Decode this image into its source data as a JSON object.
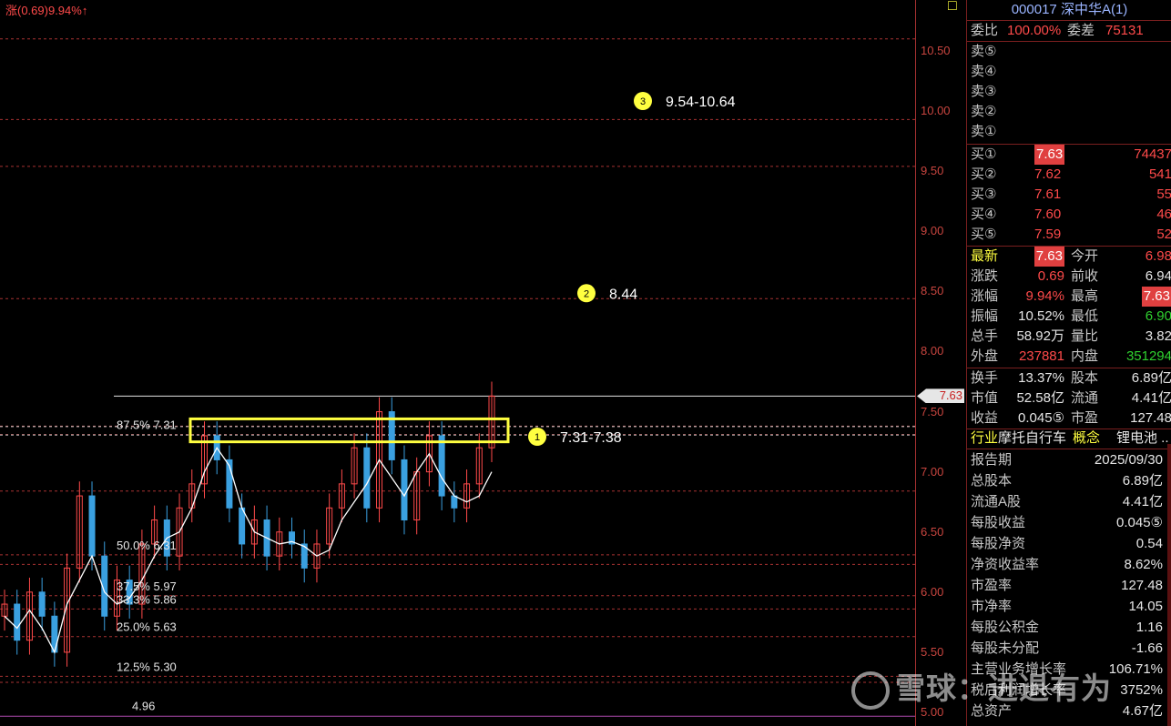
{
  "header": {
    "change_text": "涨(0.69)9.94%↑",
    "toggle_glyph": "□"
  },
  "colors": {
    "up": "#ff4a4a",
    "down": "#2fd12f",
    "accent": "#ffff40",
    "grid": "#a83232",
    "ma": "#ffffff",
    "background": "#000000"
  },
  "axis": {
    "ticks": [
      "10.50",
      "10.00",
      "9.50",
      "9.00",
      "8.50",
      "8.00",
      "7.50",
      "7.00",
      "6.50",
      "6.00",
      "5.50",
      "5.00"
    ],
    "tick_values": [
      10.5,
      10.0,
      9.5,
      9.0,
      8.5,
      8.0,
      7.5,
      7.0,
      6.5,
      6.0,
      5.5,
      5.0
    ],
    "current_price_tag": "7.63",
    "current_price": 7.63
  },
  "chart_data": {
    "type": "candlestick",
    "ylim": [
      4.96,
      10.7
    ],
    "current_price": 7.63,
    "fib_levels": [
      {
        "label": "87.5% 7.31",
        "value": 7.31
      },
      {
        "label": "50.0% 6.31",
        "value": 6.31
      },
      {
        "label": "37.5% 5.97",
        "value": 5.97
      },
      {
        "label": "33.3% 5.86",
        "value": 5.86
      },
      {
        "label": "25.0% 5.63",
        "value": 5.63
      },
      {
        "label": "12.5% 5.30",
        "value": 5.3
      }
    ],
    "low_label": "4.96",
    "low_value": 4.96,
    "resistance_zone": {
      "low": 7.31,
      "high": 7.38
    },
    "targets": [
      {
        "number": "1",
        "text": "7.31-7.38",
        "value": 7.31
      },
      {
        "number": "2",
        "text": "8.44",
        "value": 8.44
      },
      {
        "number": "3",
        "text": "9.54-10.64",
        "value": 9.94
      }
    ],
    "dashed_levels": [
      10.6,
      9.93,
      9.54,
      8.44,
      7.38,
      7.31,
      6.84,
      6.31,
      6.23,
      5.97,
      5.86,
      5.63,
      5.3,
      5.25
    ],
    "ma_line": [
      5.8,
      5.7,
      5.85,
      5.7,
      5.5,
      5.9,
      6.1,
      6.3,
      6.0,
      5.9,
      5.95,
      6.1,
      6.3,
      6.45,
      6.5,
      6.7,
      7.0,
      7.2,
      7.05,
      6.7,
      6.5,
      6.45,
      6.4,
      6.42,
      6.38,
      6.3,
      6.35,
      6.6,
      6.75,
      6.9,
      7.1,
      6.95,
      6.8,
      7.0,
      7.15,
      6.95,
      6.8,
      6.75,
      6.8,
      7.0
    ],
    "candles_close": [
      5.9,
      5.6,
      6.0,
      5.8,
      5.5,
      6.2,
      6.8,
      6.3,
      5.8,
      6.1,
      5.9,
      6.4,
      6.6,
      6.3,
      6.7,
      6.9,
      7.3,
      7.1,
      6.7,
      6.4,
      6.6,
      6.3,
      6.5,
      6.4,
      6.2,
      6.4,
      6.7,
      6.9,
      7.2,
      6.7,
      7.5,
      7.1,
      6.6,
      7.0,
      7.3,
      6.8,
      6.7,
      6.9,
      7.2,
      7.63
    ]
  },
  "quote_panel": {
    "title": "000017 深中华A(1)",
    "weibi_label": "委比",
    "weibi_value": "100.00%",
    "weicha_label": "委差",
    "weicha_value": "75131",
    "sells": [
      {
        "label": "卖⑤"
      },
      {
        "label": "卖④"
      },
      {
        "label": "卖③"
      },
      {
        "label": "卖②"
      },
      {
        "label": "卖①"
      }
    ],
    "buys": [
      {
        "label": "买①",
        "price": "7.63",
        "vol": "74437"
      },
      {
        "label": "买②",
        "price": "7.62",
        "vol": "541"
      },
      {
        "label": "买③",
        "price": "7.61",
        "vol": "55"
      },
      {
        "label": "买④",
        "price": "7.60",
        "vol": "46"
      },
      {
        "label": "买⑤",
        "price": "7.59",
        "vol": "52"
      }
    ],
    "stats": [
      {
        "l1": "最新",
        "v1": "7.63",
        "c1": "hl",
        "l2": "今开",
        "v2": "6.98",
        "c2": "red"
      },
      {
        "l1": "涨跌",
        "v1": "0.69",
        "c1": "red",
        "l2": "前收",
        "v2": "6.94",
        "c2": "white"
      },
      {
        "l1": "涨幅",
        "v1": "9.94%",
        "c1": "red",
        "l2": "最高",
        "v2": "7.63",
        "c2": "hl"
      },
      {
        "l1": "振幅",
        "v1": "10.52%",
        "c1": "white",
        "l2": "最低",
        "v2": "6.90",
        "c2": "green"
      },
      {
        "l1": "总手",
        "v1": "58.92万",
        "c1": "white",
        "l2": "量比",
        "v2": "3.82",
        "c2": "white"
      },
      {
        "l1": "外盘",
        "v1": "237881",
        "c1": "red",
        "l2": "内盘",
        "v2": "351294",
        "c2": "green"
      }
    ],
    "stats2": [
      {
        "l1": "换手",
        "v1": "13.37%",
        "l2": "股本",
        "v2": "6.89亿"
      },
      {
        "l1": "市值",
        "v1": "52.58亿",
        "l2": "流通",
        "v2": "4.41亿"
      },
      {
        "l1": "收益",
        "v1": "0.045⑤",
        "l2": "市盈",
        "v2": "127.48"
      }
    ],
    "industry_label": "行业",
    "industry_value": "摩托自行车",
    "concept_label": "概念",
    "concept_value": "锂电池 ..",
    "finance": [
      {
        "label": "报告期",
        "value": "2025/09/30"
      },
      {
        "label": "总股本",
        "value": "6.89亿"
      },
      {
        "label": "流通A股",
        "value": "4.41亿"
      },
      {
        "label": "每股收益",
        "value": "0.045⑤"
      },
      {
        "label": "每股净资",
        "value": "0.54"
      },
      {
        "label": "净资收益率",
        "value": "8.62%"
      },
      {
        "label": "市盈率",
        "value": "127.48"
      },
      {
        "label": "市净率",
        "value": "14.05"
      },
      {
        "label": "每股公积金",
        "value": "1.16"
      },
      {
        "label": "每股未分配",
        "value": "-1.66"
      },
      {
        "label": "主营业务增长率",
        "value": "106.71%"
      },
      {
        "label": "税后利润增长率",
        "value": "3752%"
      },
      {
        "label": "总资产",
        "value": "4.67亿"
      }
    ]
  },
  "watermark": {
    "text": "雪球：进退有为"
  }
}
